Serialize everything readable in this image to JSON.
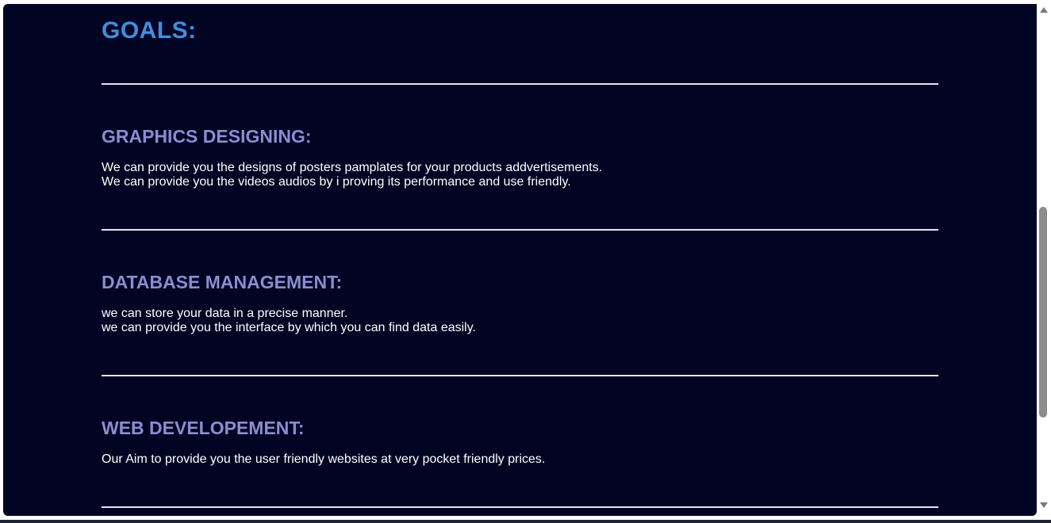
{
  "goals": {
    "title": "GOALS:"
  },
  "sections": [
    {
      "title": "GRAPHICS DESIGNING:",
      "lines": [
        "We can provide you the designs of posters pamplates for your products addvertisements.",
        "We can provide you the videos audios by i proving its performance and use friendly."
      ]
    },
    {
      "title": "DATABASE MANAGEMENT:",
      "lines": [
        "we can store your data in a precise manner.",
        "we can provide you the interface by which you can find data easily."
      ]
    },
    {
      "title": "WEB DEVELOPEMENT:",
      "lines": [
        "Our Aim to provide you the user friendly websites at very pocket friendly prices."
      ]
    }
  ],
  "colors": {
    "background": "#020423",
    "goals_title": "#3f8fe0",
    "section_title": "#8a8ed0",
    "body_text": "#ffffff",
    "divider": "#e6e6ee"
  },
  "icons": {
    "scroll_up": "scroll-up-arrow-icon",
    "scroll_down": "scroll-down-arrow-icon"
  }
}
